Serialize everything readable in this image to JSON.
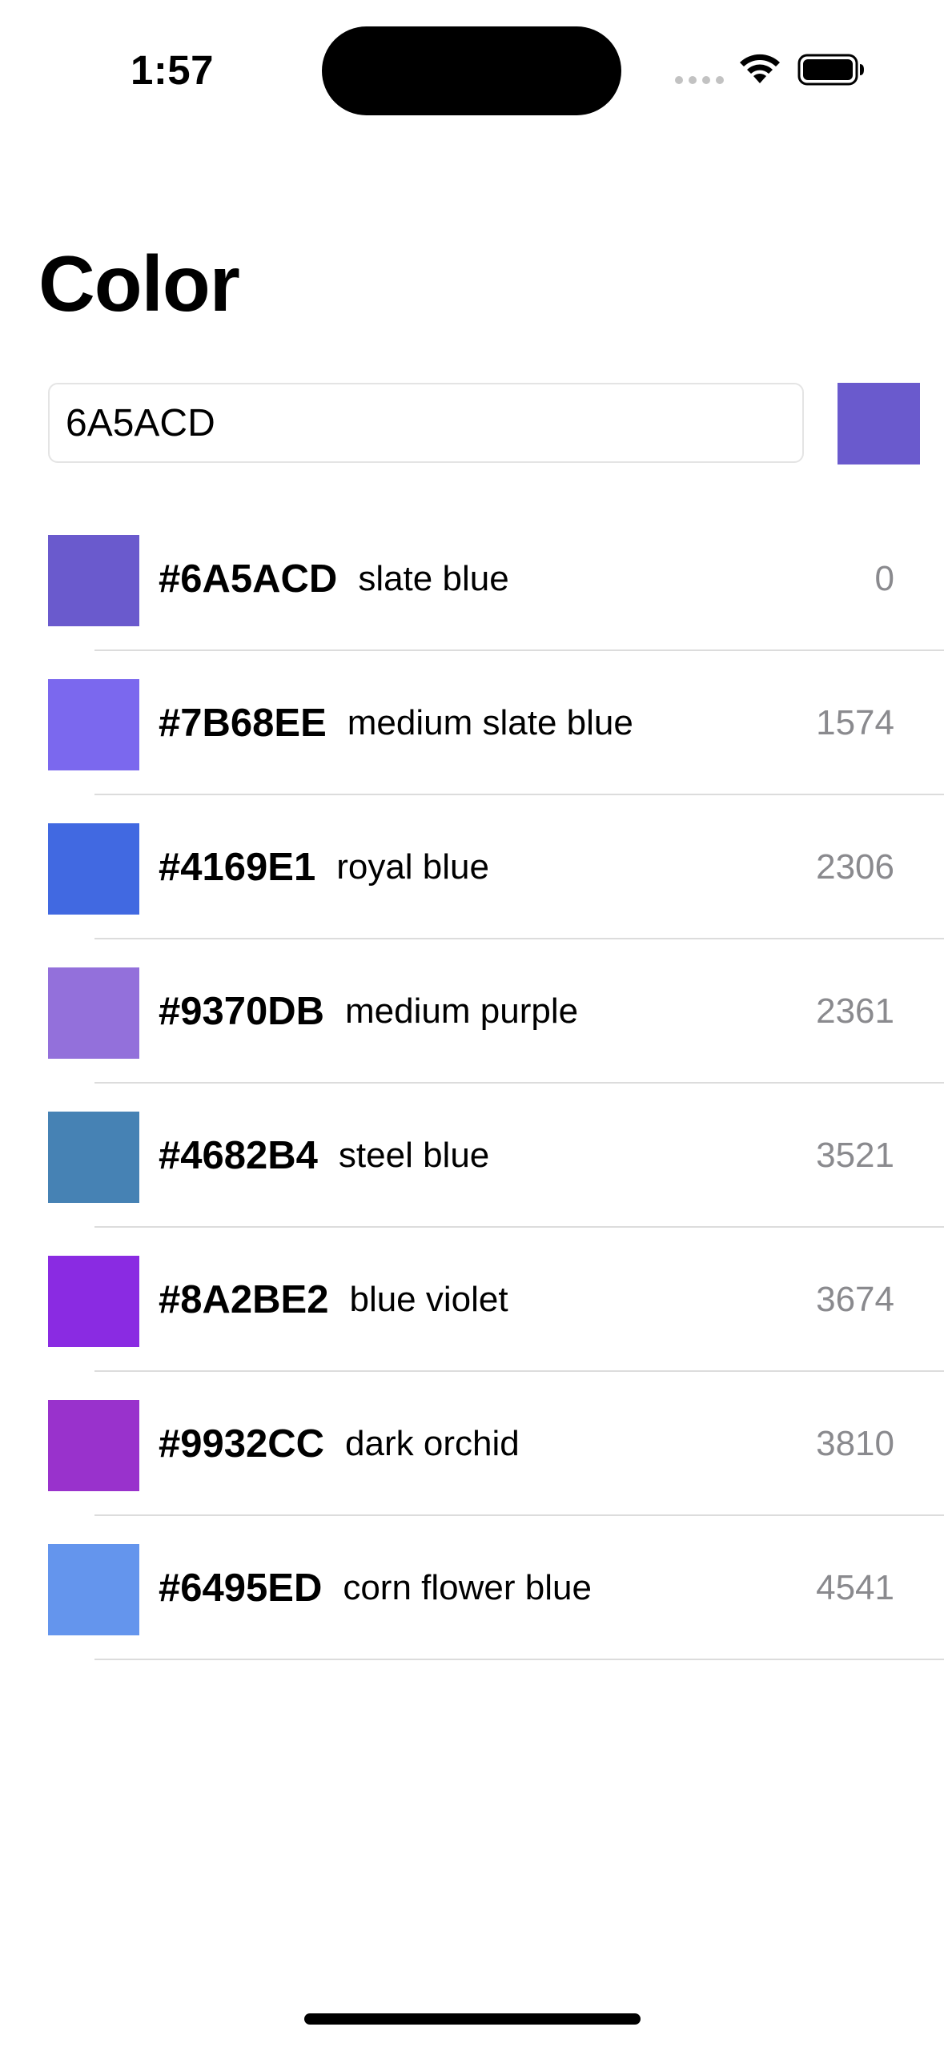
{
  "status_bar": {
    "time": "1:57"
  },
  "title": "Color",
  "input": {
    "value": "6A5ACD",
    "placeholder": ""
  },
  "preview_color": "#6A5ACD",
  "colors": [
    {
      "hex": "#6A5ACD",
      "name": "slate blue",
      "distance": "0",
      "color": "#6A5ACD"
    },
    {
      "hex": "#7B68EE",
      "name": "medium slate blue",
      "distance": "1574",
      "color": "#7B68EE"
    },
    {
      "hex": "#4169E1",
      "name": "royal blue",
      "distance": "2306",
      "color": "#4169E1"
    },
    {
      "hex": "#9370DB",
      "name": "medium purple",
      "distance": "2361",
      "color": "#9370DB"
    },
    {
      "hex": "#4682B4",
      "name": "steel blue",
      "distance": "3521",
      "color": "#4682B4"
    },
    {
      "hex": "#8A2BE2",
      "name": "blue violet",
      "distance": "3674",
      "color": "#8A2BE2"
    },
    {
      "hex": "#9932CC",
      "name": "dark orchid",
      "distance": "3810",
      "color": "#9932CC"
    },
    {
      "hex": "#6495ED",
      "name": "corn flower blue",
      "distance": "4541",
      "color": "#6495ED"
    }
  ]
}
